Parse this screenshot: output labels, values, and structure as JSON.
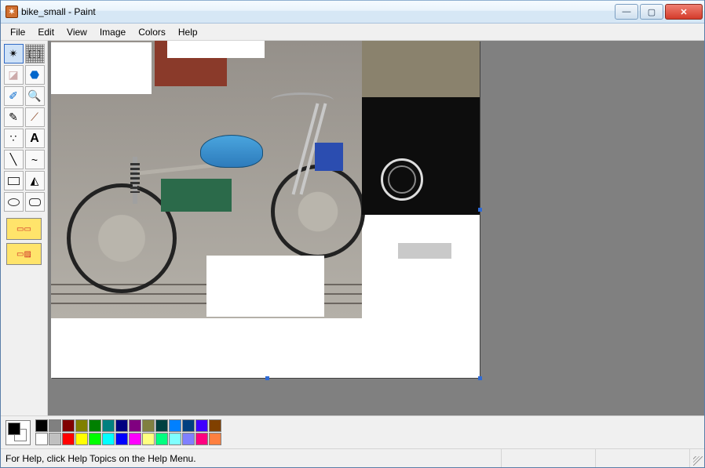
{
  "title": "bike_small - Paint",
  "menu": {
    "file": "File",
    "edit": "Edit",
    "view": "View",
    "image": "Image",
    "colors": "Colors",
    "help": "Help"
  },
  "tools": {
    "free_select": "free-form-select",
    "rect_select": "rectangle-select",
    "eraser": "eraser",
    "fill": "fill",
    "picker": "color-picker",
    "magnifier": "magnifier",
    "pencil": "pencil",
    "brush": "brush",
    "airbrush": "airbrush",
    "text": "text",
    "line": "line",
    "curve": "curve",
    "rectangle": "rectangle",
    "polygon": "polygon",
    "ellipse": "ellipse",
    "rounded": "rounded-rectangle"
  },
  "palette": {
    "foreground": "#000000",
    "background": "#ffffff",
    "row1": [
      "#000000",
      "#808080",
      "#800000",
      "#808000",
      "#008000",
      "#008080",
      "#000080",
      "#800080",
      "#808040",
      "#004040",
      "#0080ff",
      "#004080",
      "#4000ff",
      "#804000"
    ],
    "row2": [
      "#ffffff",
      "#c0c0c0",
      "#ff0000",
      "#ffff00",
      "#00ff00",
      "#00ffff",
      "#0000ff",
      "#ff00ff",
      "#ffff80",
      "#00ff80",
      "#80ffff",
      "#8080ff",
      "#ff0080",
      "#ff8040"
    ]
  },
  "status": "For Help, click Help Topics on the Help Menu."
}
